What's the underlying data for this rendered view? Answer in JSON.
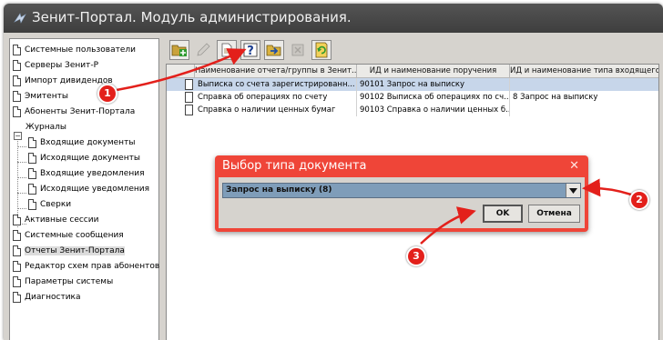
{
  "window": {
    "title": "Зенит-Портал. Модуль администрирования."
  },
  "tree": {
    "items": [
      {
        "label": "Системные пользователи"
      },
      {
        "label": "Серверы Зенит-Р"
      },
      {
        "label": "Импорт дивидендов"
      },
      {
        "label": "Эмитенты"
      },
      {
        "label": "Абоненты Зенит-Портала"
      },
      {
        "label": "Журналы"
      },
      {
        "label": "Входящие документы"
      },
      {
        "label": "Исходящие документы"
      },
      {
        "label": "Входящие уведомления"
      },
      {
        "label": "Исходящие уведомления"
      },
      {
        "label": "Сверки"
      },
      {
        "label": "Активные сессии"
      },
      {
        "label": "Системные сообщения"
      },
      {
        "label": "Отчеты Зенит-Портала"
      },
      {
        "label": "Редактор схем прав абонентов"
      },
      {
        "label": "Параметры системы"
      },
      {
        "label": "Диагностика"
      }
    ],
    "expander": "−",
    "selected_index": 13
  },
  "toolbar": {
    "buttons": [
      {
        "icon": "add-folder-icon"
      },
      {
        "icon": "edit-pencil-icon"
      },
      {
        "icon": "document-icon"
      },
      {
        "icon": "help-question-icon"
      },
      {
        "icon": "folder-arrow-icon"
      },
      {
        "icon": "delete-icon"
      },
      {
        "icon": "refresh-icon"
      }
    ]
  },
  "grid": {
    "columns": [
      "Наименование отчета/группы в Зенит...",
      "ИД и наименование поручения",
      "ИД и наименование типа входящего ..."
    ],
    "rows": [
      [
        "Выписка со счета зарегистрированн...",
        "90101 Запрос на выписку",
        ""
      ],
      [
        "Справка об операциях по счету",
        "90102 Выписка об операциях по сч...",
        "8 Запрос на выписку"
      ],
      [
        "Справка о наличии ценных бумаг",
        "90103 Справка о наличии ценных б...",
        ""
      ]
    ],
    "selected_row": 0
  },
  "dialog": {
    "title": "Выбор типа документа",
    "close": "✕",
    "combo_value": "Запрос на выписку (8)",
    "ok_label": "OK",
    "cancel_label": "Отмена"
  },
  "annotations": {
    "badges": [
      "1",
      "2",
      "3"
    ],
    "color": "#e3201b"
  },
  "colors": {
    "titlebar": "#4a4a4a",
    "dialog_accent": "#ef4538",
    "selection": "#c7d6ea"
  }
}
